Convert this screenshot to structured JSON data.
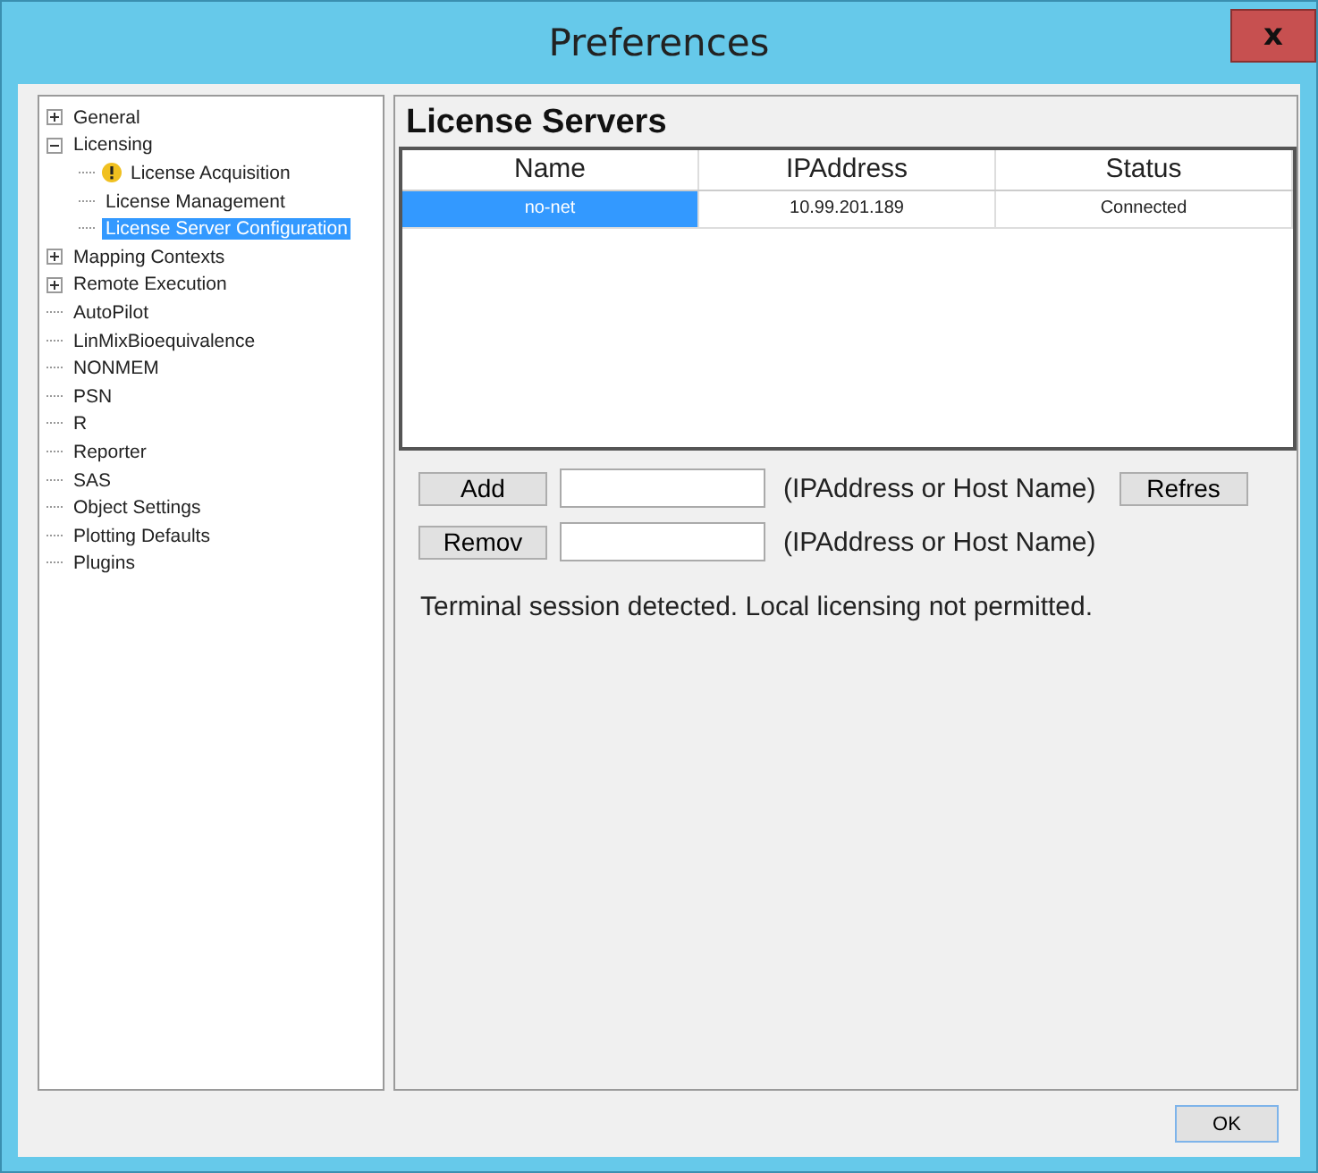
{
  "window": {
    "title": "Preferences",
    "close": "x"
  },
  "tree": [
    {
      "label": "General",
      "expanded": false,
      "selected": false
    },
    {
      "label": "Licensing",
      "expanded": true,
      "selected": false,
      "children": [
        {
          "label": "License Acquisition",
          "warning": true,
          "selected": false
        },
        {
          "label": "License Management",
          "warning": false,
          "selected": false
        },
        {
          "label": "License Server Configuration",
          "warning": false,
          "selected": true
        }
      ]
    },
    {
      "label": "Mapping Contexts",
      "expanded": false,
      "selected": false
    },
    {
      "label": "Remote Execution",
      "expanded": false,
      "selected": false
    },
    {
      "label": "AutoPilot",
      "selected": false
    },
    {
      "label": "LinMixBioequivalence",
      "selected": false
    },
    {
      "label": "NONMEM",
      "selected": false
    },
    {
      "label": "PSN",
      "selected": false
    },
    {
      "label": "R",
      "selected": false
    },
    {
      "label": "Reporter",
      "selected": false
    },
    {
      "label": "SAS",
      "selected": false
    },
    {
      "label": "Object Settings",
      "selected": false
    },
    {
      "label": "Plotting Defaults",
      "selected": false
    },
    {
      "label": "Plugins",
      "selected": false
    }
  ],
  "heading": "License Servers",
  "table": {
    "columns": [
      "Name",
      "IPAddress",
      "Status"
    ],
    "rows": [
      {
        "cells": [
          "no-net",
          "10.99.201.189",
          "Connected"
        ],
        "selected": true
      }
    ]
  },
  "server_rows": [
    {
      "button": "Add",
      "hint": "(IPAddress or Host Name)",
      "extra_button": "Refres"
    },
    {
      "button": "Remov",
      "hint": "(IPAddress or Host Name)"
    }
  ],
  "message": "Terminal session detected. Local licensing not permitted.",
  "ok_button": "OK"
}
